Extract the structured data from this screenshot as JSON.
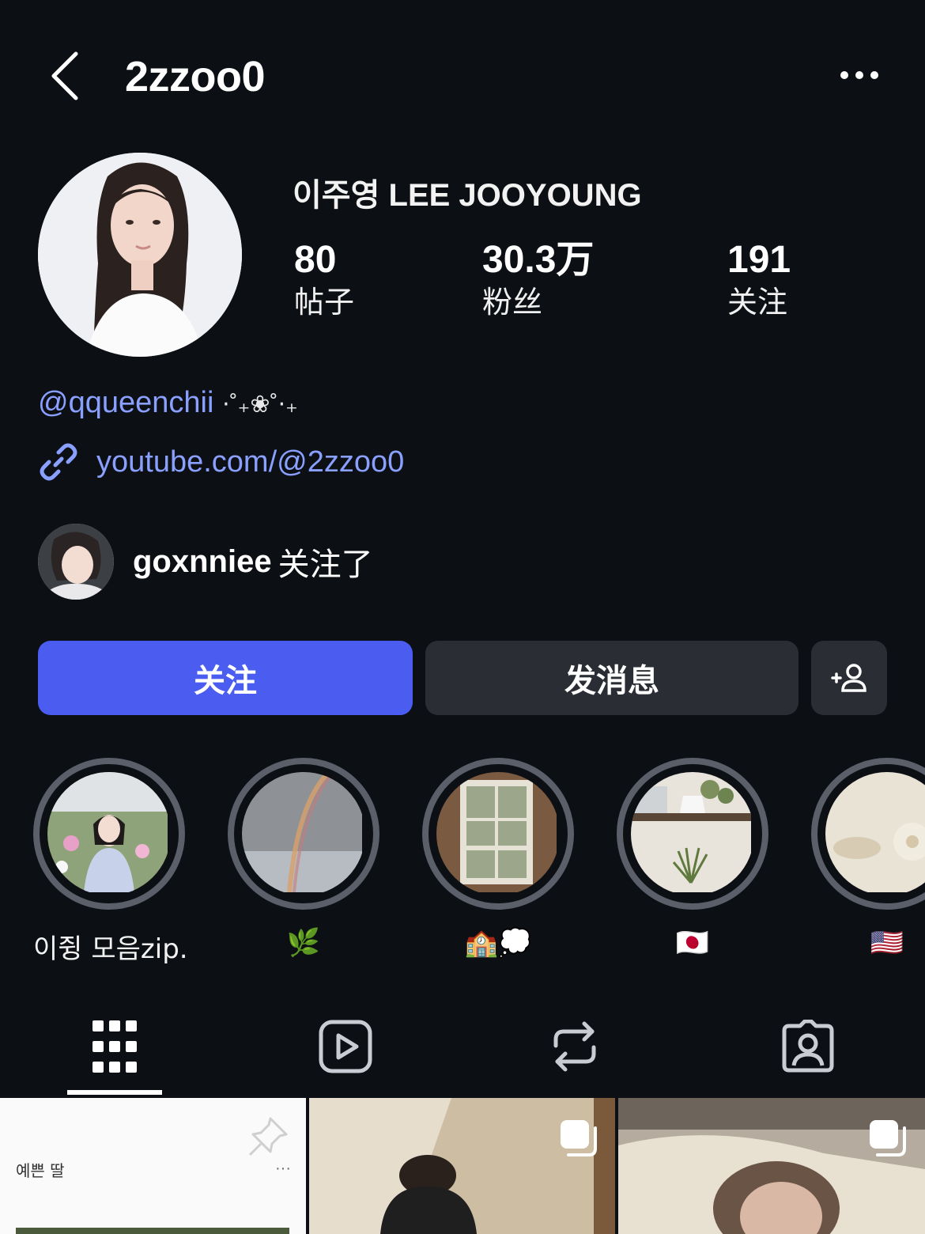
{
  "header": {
    "username": "2zzoo0"
  },
  "profile": {
    "display_name": "이주영 LEE JOOYOUNG",
    "stats": [
      {
        "value": "80",
        "label": "帖子"
      },
      {
        "value": "30.3万",
        "label": "粉丝"
      },
      {
        "value": "191",
        "label": "关注"
      }
    ],
    "mention": "@qqueenchii",
    "mention_deco": "⋅˚₊❀˚⋅₊",
    "link": "youtube.com/@2zzoo0",
    "followed_by": {
      "user": "goxnniee",
      "text": "关注了"
    }
  },
  "actions": {
    "follow": "关注",
    "message": "发消息"
  },
  "highlights": [
    {
      "label": "이쥥 모음zip."
    },
    {
      "label": "🌿"
    },
    {
      "label": "🏫💭"
    },
    {
      "label": "🇯🇵"
    },
    {
      "label": "🇺🇸"
    }
  ],
  "tabs": [
    "grid-icon",
    "reels-icon",
    "reposts-icon",
    "tagged-icon"
  ],
  "posts": [
    {
      "caption": "예쁜 딸",
      "more": "···"
    }
  ],
  "colors": {
    "background": "#0c0f14",
    "accent": "#4a5df0",
    "link": "#8aa0ff",
    "button_secondary": "#2a2d33"
  }
}
